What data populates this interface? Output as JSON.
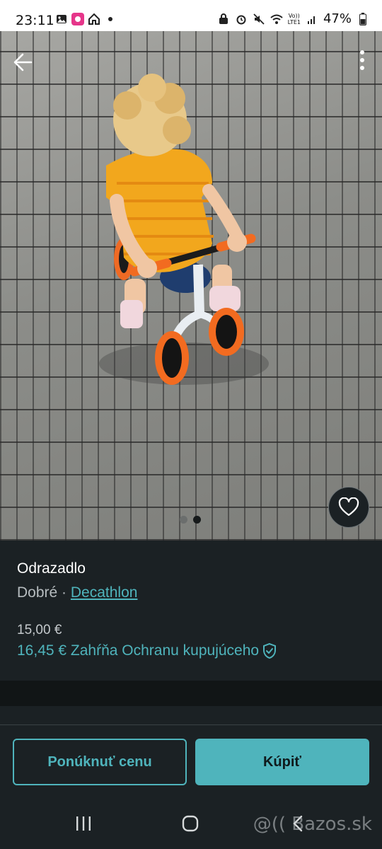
{
  "status_bar": {
    "time": "23:11",
    "battery": "47%",
    "network_top": "Vo))",
    "network_bottom": "LTE1"
  },
  "icons": {
    "back": "arrow-left-icon",
    "more": "more-vertical-icon",
    "favorite": "heart-icon",
    "protection": "shield-check-icon"
  },
  "gallery": {
    "image_count": 2,
    "active_index": 1
  },
  "item": {
    "title": "Odrazadlo",
    "condition": "Dobré",
    "separator": "·",
    "brand": "Decathlon",
    "price": "15,00 €",
    "price_with_protection": "16,45 € Zahŕňa Ochranu kupujúceho"
  },
  "actions": {
    "offer_label": "Ponúknuť cenu",
    "buy_label": "Kúpiť"
  },
  "watermark": "@(( Bazos.sk",
  "colors": {
    "accent": "#4fb4bc",
    "background": "#1b2124"
  }
}
